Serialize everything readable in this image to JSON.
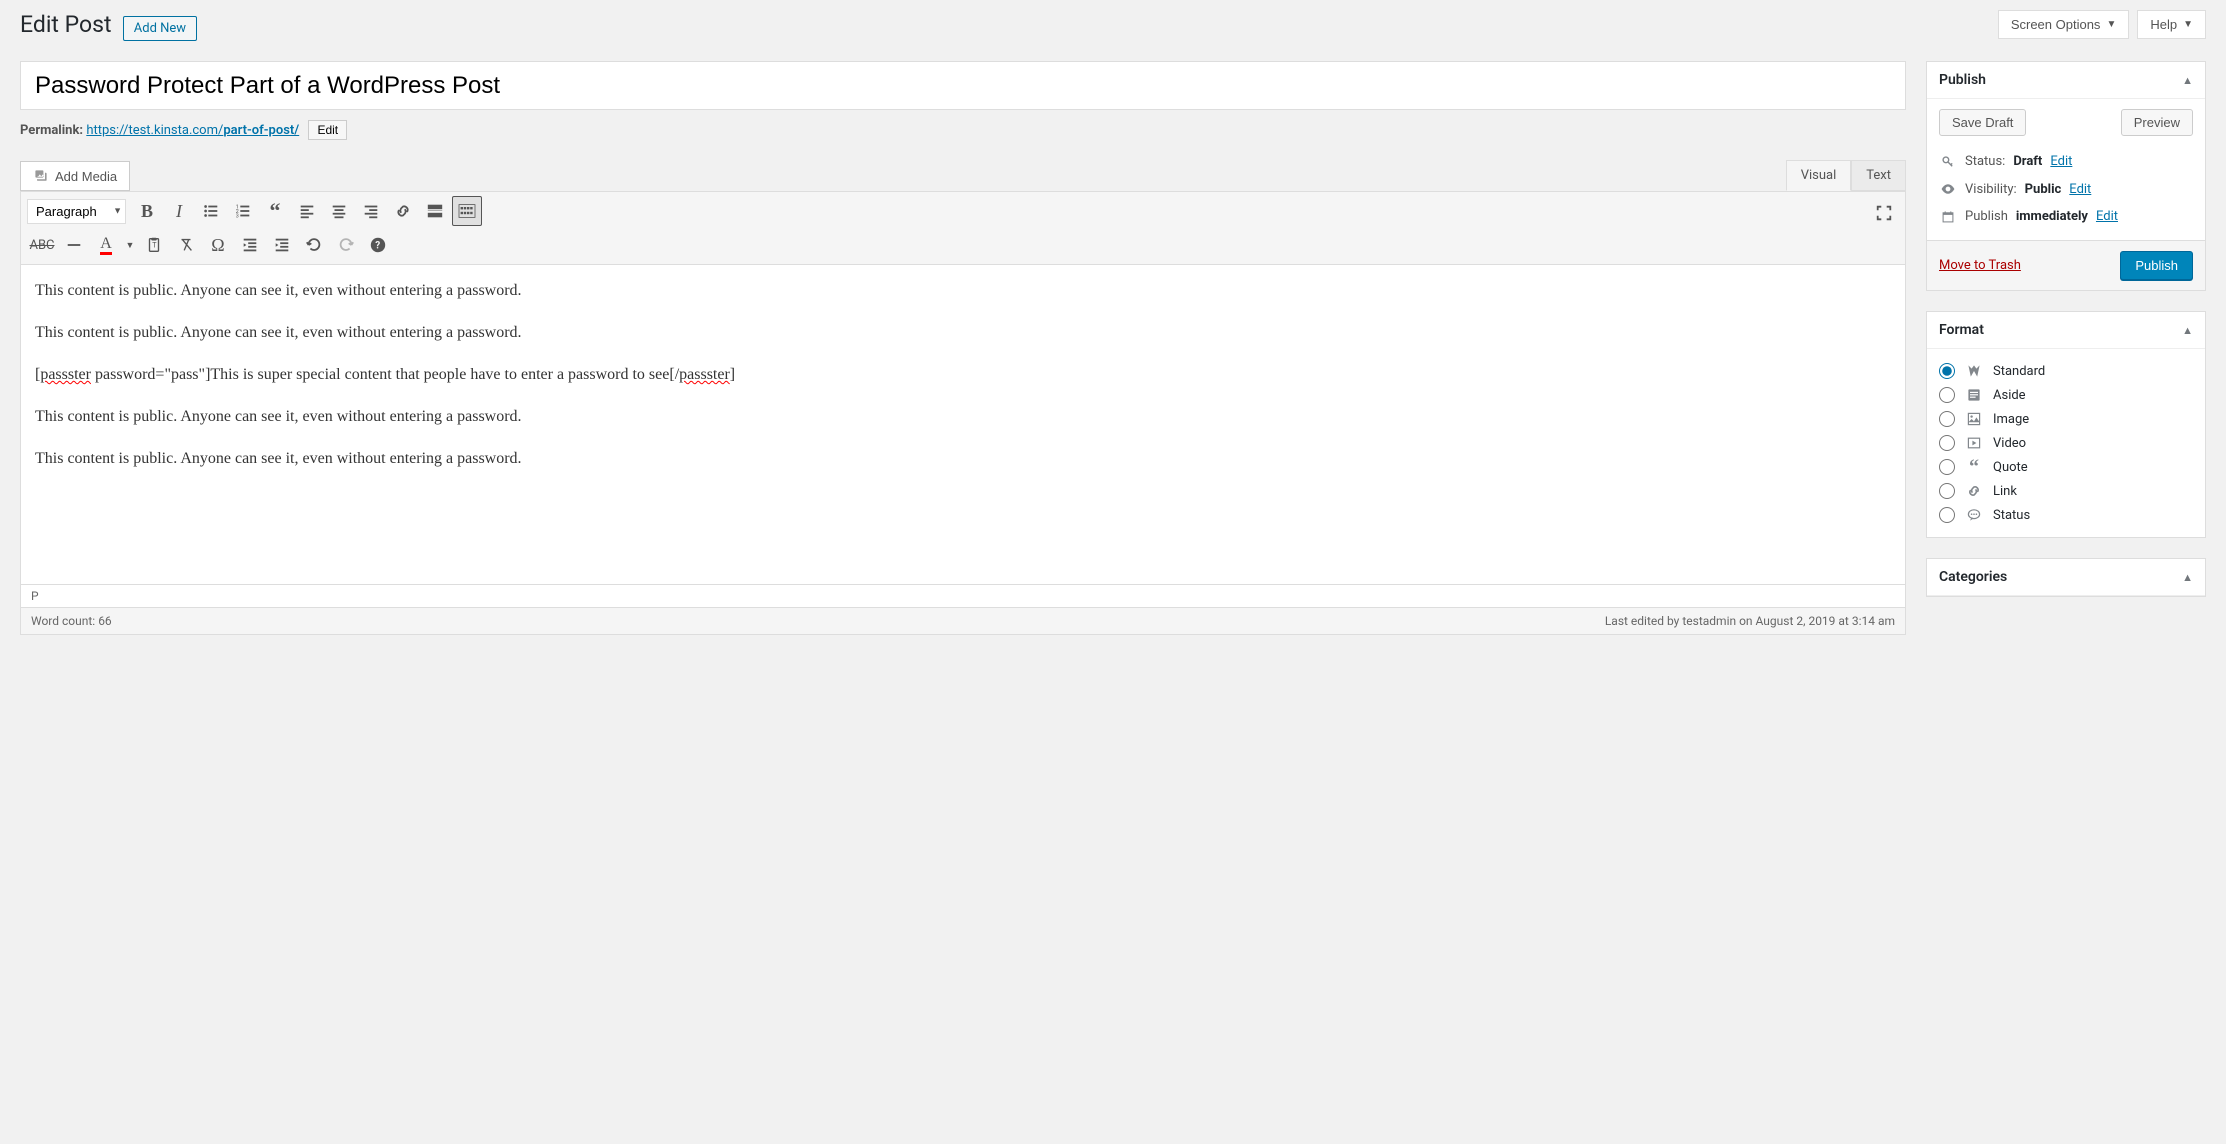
{
  "topbar": {
    "screen_options": "Screen Options",
    "help": "Help"
  },
  "header": {
    "title": "Edit Post",
    "add_new": "Add New"
  },
  "post": {
    "title": "Password Protect Part of a WordPress Post",
    "permalink_label": "Permalink:",
    "permalink_base": "https://test.kinsta.com/",
    "permalink_slug": "part-of-post/",
    "permalink_edit": "Edit"
  },
  "media": {
    "add_media": "Add Media"
  },
  "tabs": {
    "visual": "Visual",
    "text": "Text"
  },
  "toolbar": {
    "format_select": "Paragraph"
  },
  "content": {
    "p1": "This content is public. Anyone can see it, even without entering a password.",
    "p2": "This content is public. Anyone can see it, even without entering a password.",
    "shortcode_open1": "[",
    "shortcode_tag1": "passster",
    "shortcode_attr": " password=\"pass\"]This is super special content that people have to enter a password to see[/",
    "shortcode_tag2": "passster",
    "shortcode_close": "]",
    "p4": "This content is public. Anyone can see it, even without entering a password.",
    "p5": "This content is public. Anyone can see it, even without entering a password."
  },
  "status_path": "P",
  "footer": {
    "wordcount_label": "Word count: ",
    "wordcount_value": "66",
    "last_edit": "Last edited by testadmin on August 2, 2019 at 3:14 am"
  },
  "publish": {
    "box_title": "Publish",
    "save_draft": "Save Draft",
    "preview": "Preview",
    "status_label": "Status: ",
    "status_value": "Draft",
    "status_edit": "Edit",
    "visibility_label": "Visibility: ",
    "visibility_value": "Public",
    "visibility_edit": "Edit",
    "publish_label": "Publish ",
    "publish_value": "immediately",
    "publish_edit": "Edit",
    "trash": "Move to Trash",
    "publish_btn": "Publish"
  },
  "format": {
    "box_title": "Format",
    "options": [
      {
        "id": "standard",
        "label": "Standard",
        "checked": true
      },
      {
        "id": "aside",
        "label": "Aside",
        "checked": false
      },
      {
        "id": "image",
        "label": "Image",
        "checked": false
      },
      {
        "id": "video",
        "label": "Video",
        "checked": false
      },
      {
        "id": "quote",
        "label": "Quote",
        "checked": false
      },
      {
        "id": "link",
        "label": "Link",
        "checked": false
      },
      {
        "id": "status",
        "label": "Status",
        "checked": false
      }
    ]
  },
  "categories": {
    "box_title": "Categories"
  }
}
